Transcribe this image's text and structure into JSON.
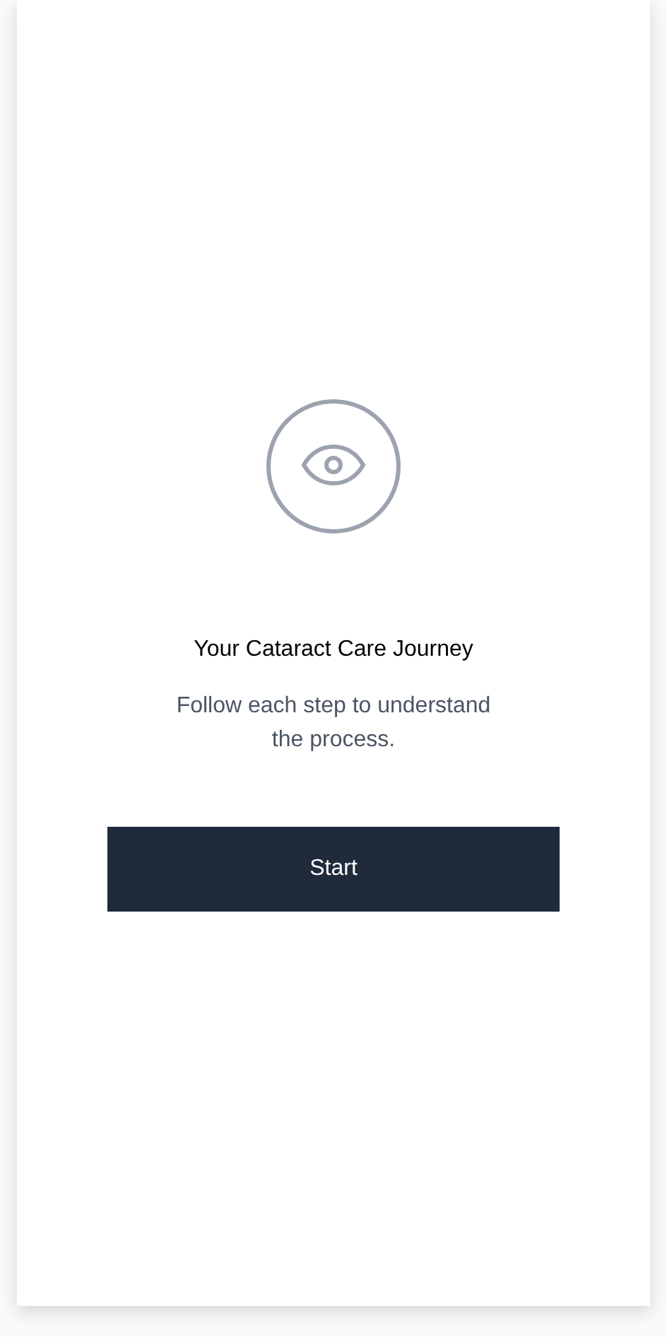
{
  "title": "Your Cataract Care Journey",
  "subtitle": "Follow each step to understand the process.",
  "button": "Start"
}
